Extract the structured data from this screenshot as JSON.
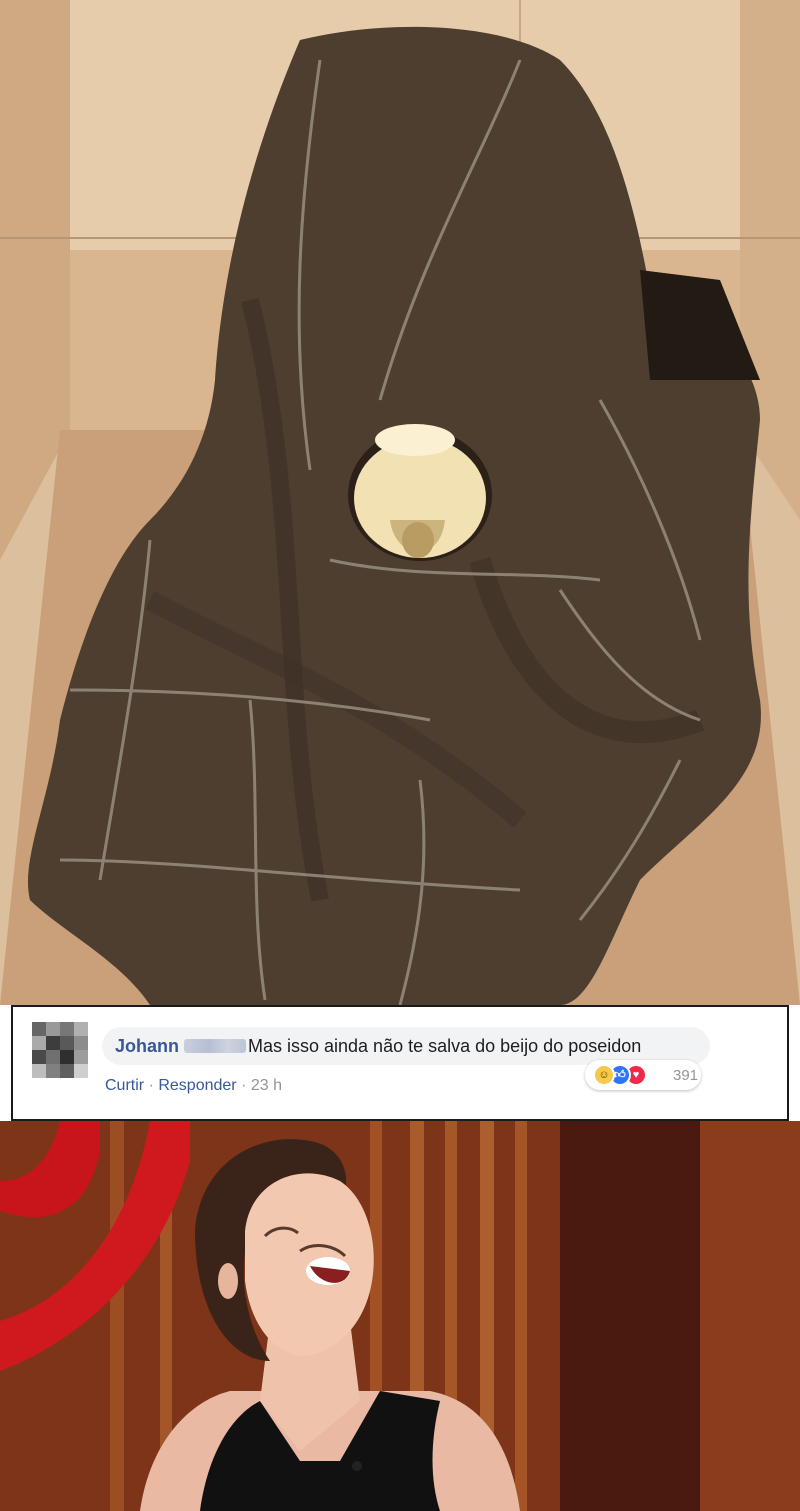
{
  "comment": {
    "author": "Johann",
    "text": "Mas isso ainda não te salva do beijo do poseidon",
    "actions": {
      "like": "Curtir",
      "separator": "·",
      "reply": "Responder",
      "time": "23 h"
    },
    "reactions": {
      "icons": [
        "haha-icon",
        "like-icon",
        "love-icon"
      ],
      "count": "391",
      "colors": {
        "haha": "#f7c94a",
        "like": "#2d74ff",
        "love": "#f0284a"
      }
    },
    "colors": {
      "author": "#385898",
      "bubble": "#f2f3f5",
      "meta": "#90949c"
    }
  },
  "images": {
    "top": "toilet-covered-with-blanket-photo",
    "bottom": "laughing-woman-photo"
  }
}
